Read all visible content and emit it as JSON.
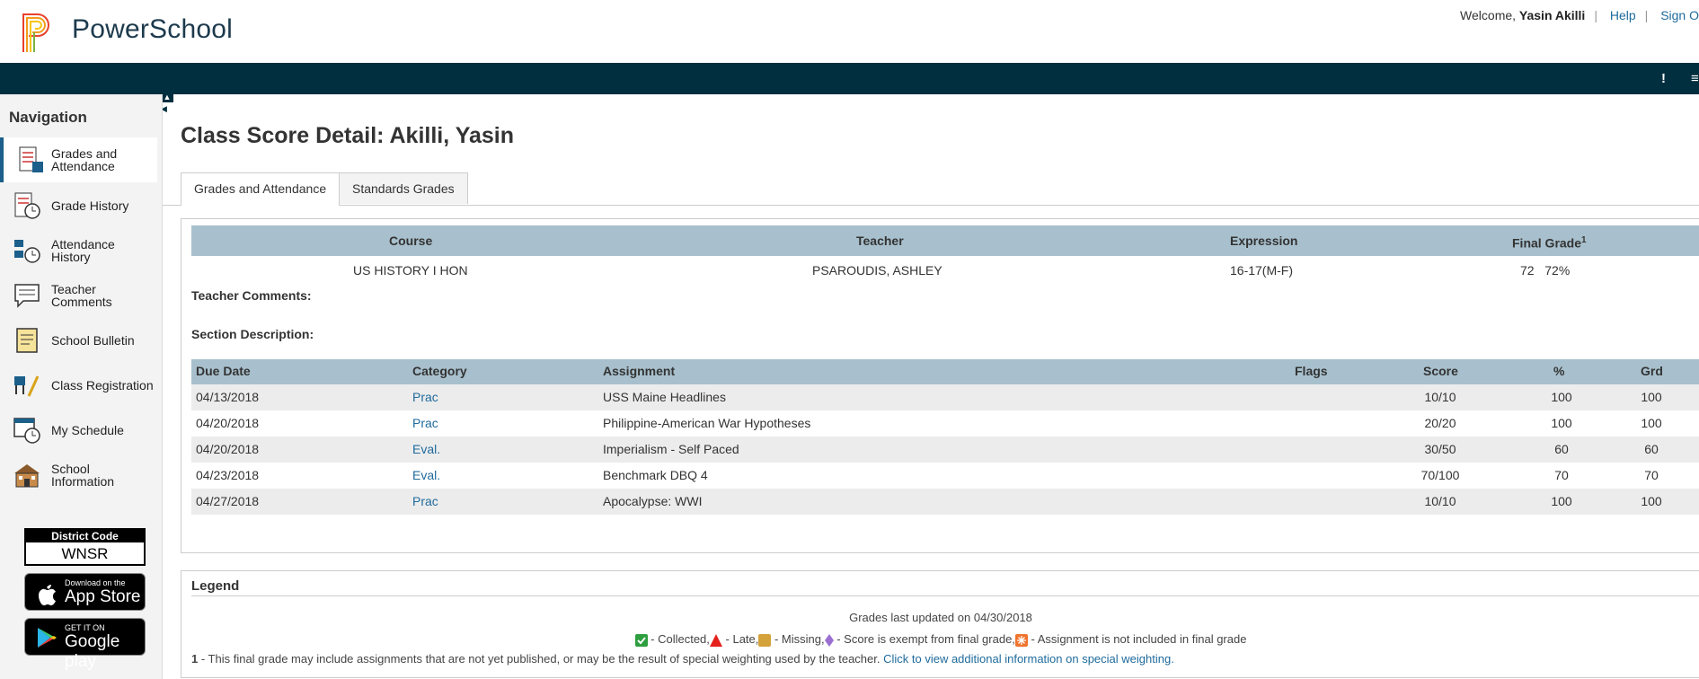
{
  "header": {
    "brand": "PowerSchool",
    "welcome": "Welcome,",
    "user_name": "Yasin Akilli",
    "help": "Help",
    "sign_out": "Sign O"
  },
  "sidebar": {
    "heading": "Navigation",
    "items": [
      {
        "label": "Grades and Attendance",
        "icon": "grades-icon"
      },
      {
        "label": "Grade History",
        "icon": "grade-history-icon"
      },
      {
        "label": "Attendance History",
        "icon": "attendance-history-icon"
      },
      {
        "label": "Teacher Comments",
        "icon": "teacher-comments-icon"
      },
      {
        "label": "School Bulletin",
        "icon": "bulletin-icon"
      },
      {
        "label": "Class Registration",
        "icon": "class-registration-icon"
      },
      {
        "label": "My Schedule",
        "icon": "schedule-icon"
      },
      {
        "label": "School Information",
        "icon": "school-info-icon"
      }
    ],
    "district_label": "District Code",
    "district_code": "WNSR",
    "appstore_small": "Download on the",
    "appstore_big": "App Store",
    "googleplay_small": "GET IT ON",
    "googleplay_big": "Google play"
  },
  "main": {
    "title": "Class Score Detail: Akilli, Yasin",
    "tabs": [
      "Grades and Attendance",
      "Standards Grades"
    ],
    "summary_headers": {
      "course": "Course",
      "teacher": "Teacher",
      "expression": "Expression",
      "final_grade": "Final Grade",
      "final_grade_sup": "1"
    },
    "summary": {
      "course": "US HISTORY I HON",
      "teacher": "PSAROUDIS, ASHLEY",
      "expression": "16-17(M-F)",
      "final_grade": "72   72%"
    },
    "teacher_comments_label": "Teacher Comments:",
    "section_description_label": "Section Description:",
    "table_headers": [
      "Due Date",
      "Category",
      "Assignment",
      "Flags",
      "Score",
      "%",
      "Grd"
    ],
    "rows": [
      {
        "date": "04/13/2018",
        "category": "Prac",
        "assignment": "USS Maine Headlines",
        "score": "10/10",
        "pct": "100",
        "grd": "100"
      },
      {
        "date": "04/20/2018",
        "category": "Prac",
        "assignment": "Philippine-American War Hypotheses",
        "score": "20/20",
        "pct": "100",
        "grd": "100"
      },
      {
        "date": "04/20/2018",
        "category": "Eval.",
        "assignment": "Imperialism - Self Paced",
        "score": "30/50",
        "pct": "60",
        "grd": "60"
      },
      {
        "date": "04/23/2018",
        "category": "Eval.",
        "assignment": "Benchmark DBQ 4",
        "score": "70/100",
        "pct": "70",
        "grd": "70"
      },
      {
        "date": "04/27/2018",
        "category": "Prac",
        "assignment": "Apocalypse: WWI",
        "score": "10/10",
        "pct": "100",
        "grd": "100"
      }
    ]
  },
  "legend": {
    "heading": "Legend",
    "updated": "Grades last updated on 04/30/2018",
    "collected": " - Collected,",
    "late": " - Late,",
    "missing": " - Missing,",
    "exempt": " - Score is exempt from final grade,",
    "not_included": " - Assignment is not included in final grade",
    "note_num": "1",
    "note_text": " - This final grade may include assignments that are not yet published, or may be the result of special weighting used by the teacher. ",
    "note_link": "Click to view additional information on special weighting."
  },
  "colors": {
    "navbar": "#022f3f",
    "table_header": "#a8c0cd",
    "link": "#1f6b9c"
  }
}
